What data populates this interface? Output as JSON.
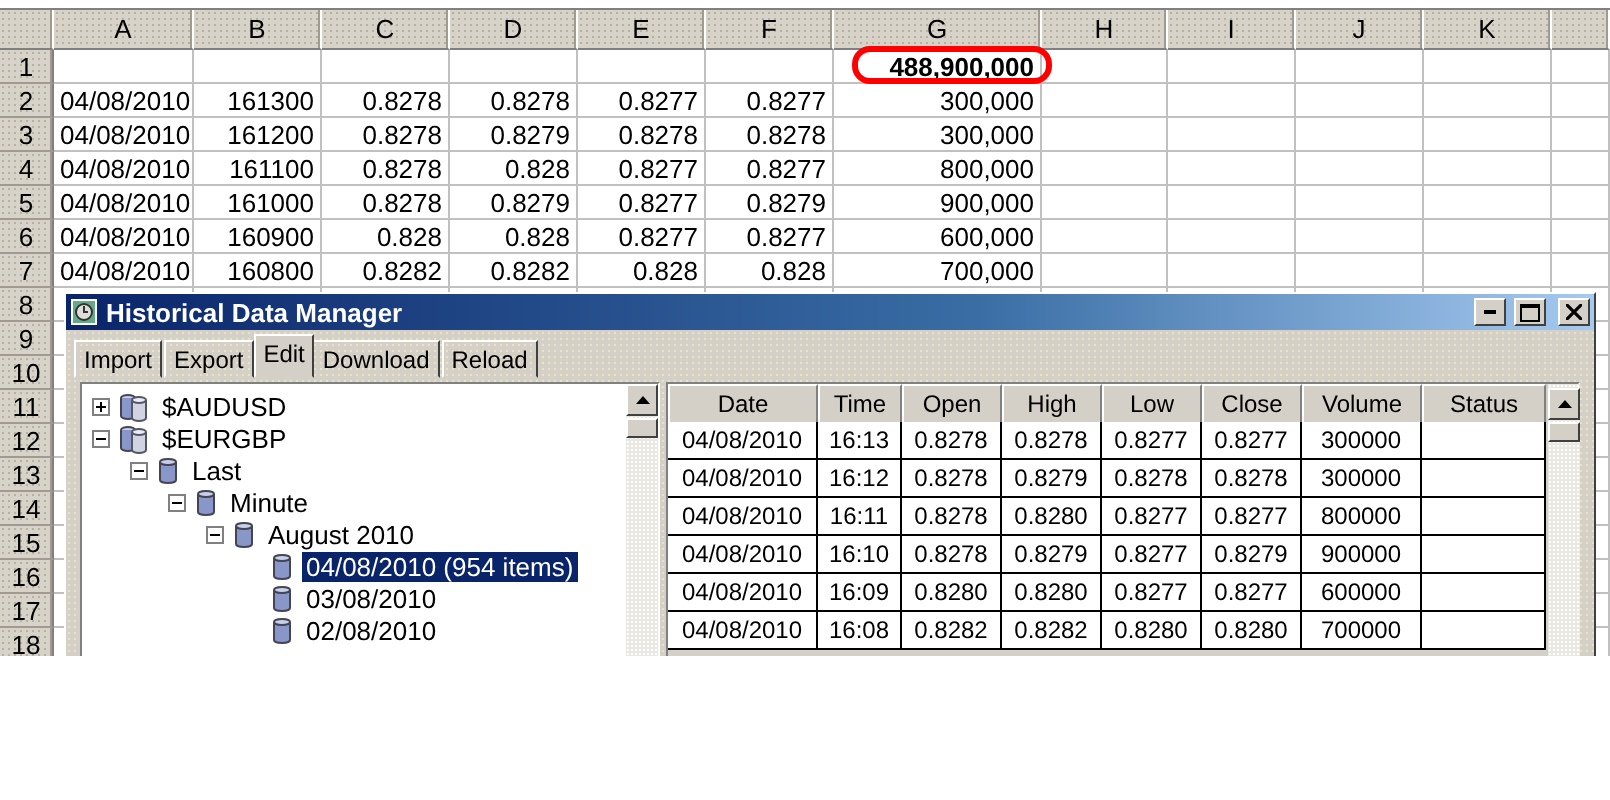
{
  "spreadsheet": {
    "columns": [
      "A",
      "B",
      "C",
      "D",
      "E",
      "F",
      "G",
      "H",
      "I",
      "J",
      "K"
    ],
    "rows": [
      {
        "number": "1",
        "total": {
          "value": "488,900,000",
          "circled": true
        }
      },
      {
        "number": "2",
        "cells": [
          "04/08/2010",
          "161300",
          "0.8278",
          "0.8278",
          "0.8277",
          "0.8277",
          "300,000"
        ]
      },
      {
        "number": "3",
        "cells": [
          "04/08/2010",
          "161200",
          "0.8278",
          "0.8279",
          "0.8278",
          "0.8278",
          "300,000"
        ]
      },
      {
        "number": "4",
        "cells": [
          "04/08/2010",
          "161100",
          "0.8278",
          "0.828",
          "0.8277",
          "0.8277",
          "800,000"
        ]
      },
      {
        "number": "5",
        "cells": [
          "04/08/2010",
          "161000",
          "0.8278",
          "0.8279",
          "0.8277",
          "0.8279",
          "900,000"
        ]
      },
      {
        "number": "6",
        "cells": [
          "04/08/2010",
          "160900",
          "0.828",
          "0.828",
          "0.8277",
          "0.8277",
          "600,000"
        ]
      },
      {
        "number": "7",
        "cells": [
          "04/08/2010",
          "160800",
          "0.8282",
          "0.8282",
          "0.828",
          "0.828",
          "700,000"
        ]
      },
      {
        "number": "8"
      },
      {
        "number": "9"
      },
      {
        "number": "10"
      },
      {
        "number": "11"
      },
      {
        "number": "12"
      },
      {
        "number": "13"
      },
      {
        "number": "14"
      },
      {
        "number": "15"
      },
      {
        "number": "16"
      },
      {
        "number": "17"
      },
      {
        "number": "18"
      }
    ]
  },
  "window": {
    "title": "Historical Data Manager",
    "tabs": [
      {
        "label": "Import",
        "selected": false
      },
      {
        "label": "Export",
        "selected": false
      },
      {
        "label": "Edit",
        "selected": true
      },
      {
        "label": "Download",
        "selected": false
      },
      {
        "label": "Reload",
        "selected": false
      }
    ],
    "tree": [
      {
        "label": "$AUDUSD",
        "kind": "symbol",
        "expanded": false,
        "selected": false
      },
      {
        "label": "$EURGBP",
        "kind": "symbol",
        "expanded": true,
        "selected": false,
        "children": [
          {
            "label": "Last",
            "kind": "group",
            "expanded": true,
            "selected": false,
            "children": [
              {
                "label": "Minute",
                "kind": "group",
                "expanded": true,
                "selected": false,
                "children": [
                  {
                    "label": "August 2010",
                    "kind": "group",
                    "expanded": true,
                    "selected": false,
                    "children": [
                      {
                        "label": "04/08/2010 (954 items)",
                        "kind": "day",
                        "selected": true
                      },
                      {
                        "label": "03/08/2010",
                        "kind": "day",
                        "selected": false
                      },
                      {
                        "label": "02/08/2010",
                        "kind": "day",
                        "selected": false
                      }
                    ]
                  }
                ]
              }
            ]
          }
        ]
      }
    ],
    "table": {
      "columns": [
        "Date",
        "Time",
        "Open",
        "High",
        "Low",
        "Close",
        "Volume",
        "Status"
      ],
      "rows": [
        [
          "04/08/2010",
          "16:13",
          "0.8278",
          "0.8278",
          "0.8277",
          "0.8277",
          "300000"
        ],
        [
          "04/08/2010",
          "16:12",
          "0.8278",
          "0.8279",
          "0.8278",
          "0.8278",
          "300000"
        ],
        [
          "04/08/2010",
          "16:11",
          "0.8278",
          "0.8280",
          "0.8277",
          "0.8277",
          "800000"
        ],
        [
          "04/08/2010",
          "16:10",
          "0.8278",
          "0.8279",
          "0.8277",
          "0.8279",
          "900000"
        ],
        [
          "04/08/2010",
          "16:09",
          "0.8280",
          "0.8280",
          "0.8277",
          "0.8277",
          "600000"
        ],
        [
          "04/08/2010",
          "16:08",
          "0.8282",
          "0.8282",
          "0.8280",
          "0.8280",
          "700000"
        ]
      ]
    }
  }
}
